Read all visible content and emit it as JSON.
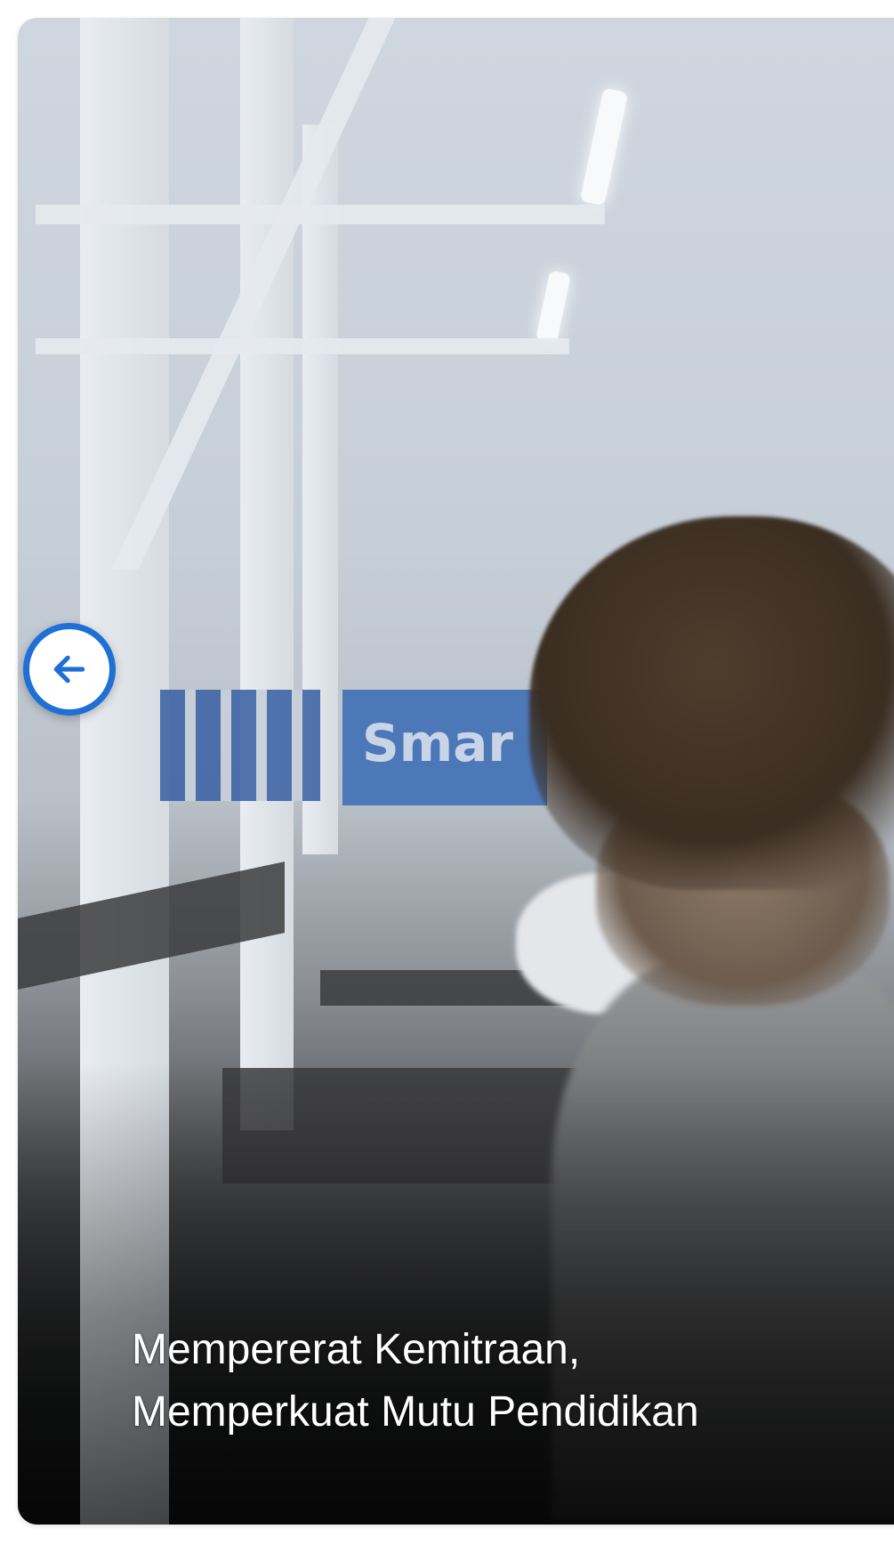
{
  "slide": {
    "image_alt": "Students working with devices in a lab",
    "banner_text": "Smar",
    "caption_line1": "Mempererat Kemitraan,",
    "caption_line2": "Memperkuat Mutu Pendidikan"
  },
  "controls": {
    "prev_icon": "arrow-left-icon",
    "accent_color": "#1f6fd6"
  }
}
